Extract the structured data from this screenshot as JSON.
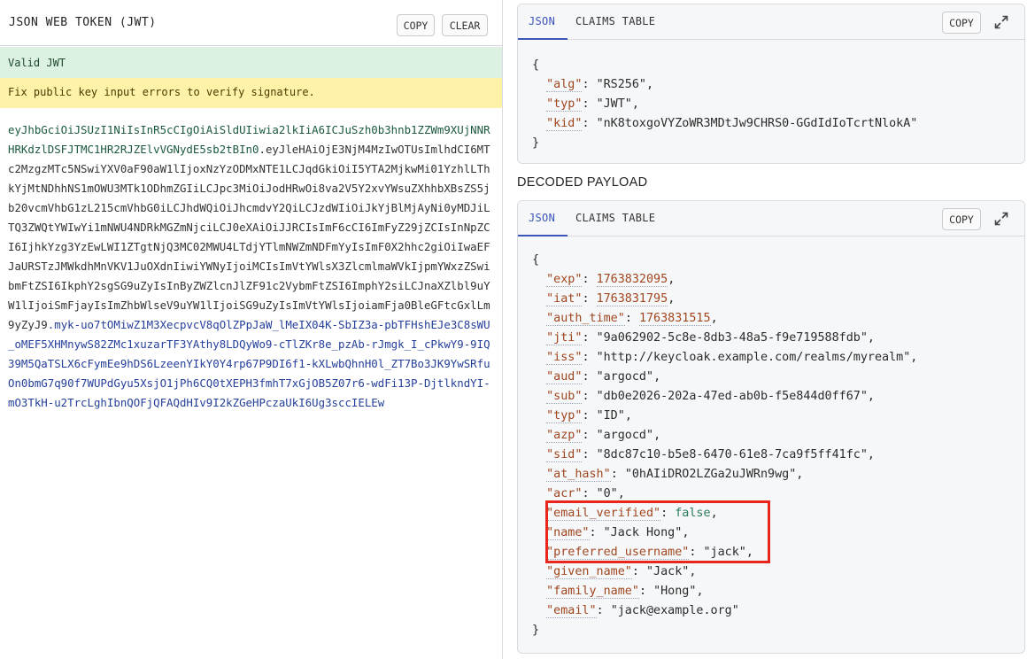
{
  "left_panel": {
    "title": "JSON WEB TOKEN (JWT)",
    "copy_label": "COPY",
    "clear_label": "CLEAR",
    "valid_text": "Valid JWT",
    "warning_text": "Fix public key input errors to verify signature.",
    "token_header": "eyJhbGciOiJSUzI1NiIsInR5cCIgOiAiSldUIiwia2lkIiA6ICJuSzh0b3hnb1ZZWm9XUjNNRHRKdzlDSFJTMC1HR2RJZElvVGNydE5sb2tBIn0",
    "token_dot1": ".",
    "token_payload": "eyJleHAiOjE3NjM4MzIwOTUsImlhdCI6MTc2MzgzMTc5NSwiYXV0aF90aW1lIjoxNzYzODMxNTE1LCJqdGkiOiI5YTA2MjkwMi01YzhlLThkYjMtNDhhNS1mOWU3MTk1ODhmZGIiLCJpc3MiOiJodHRwOi8va2V5Y2xvYWsuZXhhbXBsZS5jb20vcmVhbG1zL215cmVhbG0iLCJhdWQiOiJhcmdvY2QiLCJzdWIiOiJkYjBlMjAyNi0yMDJiLTQ3ZWQtYWIwYi1mNWU4NDRkMGZmNjciLCJ0eXAiOiJJRCIsImF6cCI6ImFyZ29jZCIsInNpZCI6IjhkYzg3YzEwLWI1ZTgtNjQ3MC02MWU4LTdjYTlmNWZmNDFmYyIsImF0X2hhc2giOiIwaEFJaURSTzJMWkdhMnVKV1JuOXdnIiwiYWNyIjoiMCIsImVtYWlsX3ZlcmlmaWVkIjpmYWxzZSwibmFtZSI6IkphY2sgSG9uZyIsInByZWZlcnJlZF91c2VybmFtZSI6ImphY2siLCJnaXZlbl9uYW1lIjoiSmFjayIsImZhbWlseV9uYW1lIjoiSG9uZyIsImVtYWlsIjoiamFja0BleGFtcGxlLm9yZyJ9",
    "token_dot2": ".",
    "token_signature": "myk-uo7tOMiwZ1M3XecpvcV8qOlZPpJaW_lMeIX04K-SbIZ3a-pbTFHshEJe3C8sWU_oMEF5XHMnywS82ZMc1xuzarTF3YAthy8LDQyWo9-cTlZKr8e_pzAb-rJmgk_I_cPkwY9-9IQ39M5QaTSLX6cFymEe9hDS6LzeenYIkY0Y4rp67P9DI6f1-kXLwbQhnH0l_ZT7Bo3JK9YwSRfuOn0bmG7q90f7WUPdGyu5XsjO1jPh6CQ0tXEPH3fmhT7xGjOB5Z07r6-wdFi13P-DjtlkndYI-mO3TkH-u2TrcLghIbnQOFjQFAQdHIv9I2kZGeHPczaUkI6Ug3sccIELEw"
  },
  "header_card": {
    "tab_json": "JSON",
    "tab_claims": "CLAIMS TABLE",
    "copy_label": "COPY",
    "open_brace": "{",
    "close_brace": "}",
    "claims": [
      {
        "key": "alg",
        "value": "RS256"
      },
      {
        "key": "typ",
        "value": "JWT"
      },
      {
        "key": "kid",
        "value": "nK8toxgoVYZoWR3MDtJw9CHRS0-GGdIdIoTcrtNlokA"
      }
    ]
  },
  "decoded_payload_title": "DECODED PAYLOAD",
  "payload_card": {
    "tab_json": "JSON",
    "tab_claims": "CLAIMS TABLE",
    "copy_label": "COPY",
    "open_brace": "{",
    "close_brace": "}",
    "claims": [
      {
        "key": "exp",
        "value": "1763832095",
        "kind": "number"
      },
      {
        "key": "iat",
        "value": "1763831795",
        "kind": "number"
      },
      {
        "key": "auth_time",
        "value": "1763831515",
        "kind": "number"
      },
      {
        "key": "jti",
        "value": "9a062902-5c8e-8db3-48a5-f9e719588fdb",
        "kind": "string"
      },
      {
        "key": "iss",
        "value": "http://keycloak.example.com/realms/myrealm",
        "kind": "string"
      },
      {
        "key": "aud",
        "value": "argocd",
        "kind": "string"
      },
      {
        "key": "sub",
        "value": "db0e2026-202a-47ed-ab0b-f5e844d0ff67",
        "kind": "string"
      },
      {
        "key": "typ",
        "value": "ID",
        "kind": "string"
      },
      {
        "key": "azp",
        "value": "argocd",
        "kind": "string"
      },
      {
        "key": "sid",
        "value": "8dc87c10-b5e8-6470-61e8-7ca9f5ff41fc",
        "kind": "string"
      },
      {
        "key": "at_hash",
        "value": "0hAIiDRO2LZGa2uJWRn9wg",
        "kind": "string"
      },
      {
        "key": "acr",
        "value": "0",
        "kind": "string"
      },
      {
        "key": "email_verified",
        "value": "false",
        "kind": "bool"
      },
      {
        "key": "name",
        "value": "Jack Hong",
        "kind": "string"
      },
      {
        "key": "preferred_username",
        "value": "jack",
        "kind": "string"
      },
      {
        "key": "given_name",
        "value": "Jack",
        "kind": "string"
      },
      {
        "key": "family_name",
        "value": "Hong",
        "kind": "string"
      },
      {
        "key": "email",
        "value": "jack@example.org",
        "kind": "string"
      }
    ]
  },
  "colors": {
    "valid_bg": "#ddf1e3",
    "warning_bg": "#fdf2a8",
    "accent_tab": "#3b55b8",
    "highlight": "#e8261e",
    "token_header": "#1b5a3d",
    "token_signature": "#243f9a"
  },
  "icons": {
    "expand": "expand-icon"
  }
}
